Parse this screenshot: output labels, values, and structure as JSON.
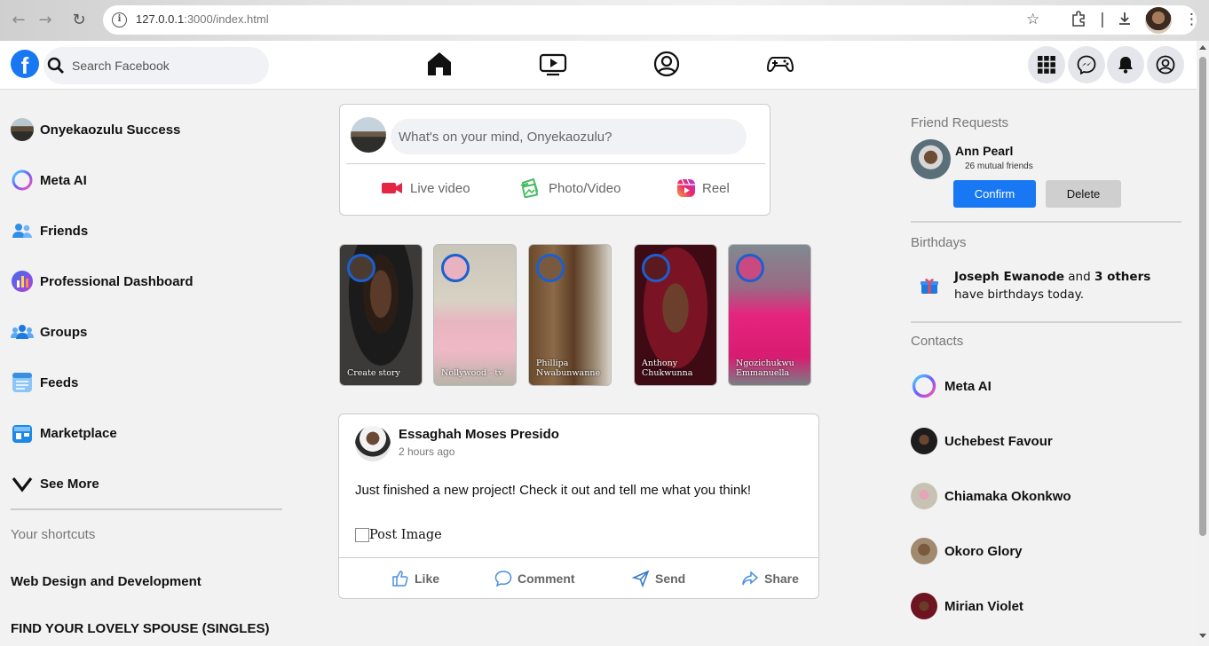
{
  "browser": {
    "url_host": "127.0.0.1",
    "url_rest": ":3000/index.html"
  },
  "header": {
    "logo_letter": "f",
    "search_placeholder": "Search Facebook"
  },
  "left_nav": {
    "items": [
      {
        "label": "Onyekaozulu Success",
        "icon": "user-avatar"
      },
      {
        "label": "Meta AI",
        "icon": "meta-ai-icon"
      },
      {
        "label": "Friends",
        "icon": "friends-icon"
      },
      {
        "label": "Professional Dashboard",
        "icon": "dashboard-icon"
      },
      {
        "label": "Groups",
        "icon": "groups-icon"
      },
      {
        "label": "Feeds",
        "icon": "feeds-icon"
      },
      {
        "label": "Marketplace",
        "icon": "marketplace-icon"
      },
      {
        "label": "See More",
        "icon": "chevron-down-icon"
      }
    ],
    "shortcuts_title": "Your shortcuts",
    "shortcuts": [
      "Web Design and Development",
      "FIND YOUR LOVELY SPOUSE (SINGLES)"
    ]
  },
  "composer": {
    "placeholder": "What's on your mind, Onyekaozulu?",
    "live_label": "Live video",
    "photo_label": "Photo/Video",
    "reel_label": "Reel"
  },
  "stories": [
    {
      "name": "Create story"
    },
    {
      "name": "Nollywood - tv"
    },
    {
      "name": "Phillipa Nwabunwanne"
    },
    {
      "name": "Anthony Chukwunna"
    },
    {
      "name": "Ngozichukwu Emmanuella"
    }
  ],
  "post": {
    "author": "Essaghah Moses Presido",
    "time": "2 hours ago",
    "text": "Just finished a new project! Check it out and tell me what you think!",
    "image_alt": "Post Image",
    "actions": {
      "like": "Like",
      "comment": "Comment",
      "send": "Send",
      "share": "Share"
    }
  },
  "right": {
    "friend_requests_title": "Friend Requests",
    "request": {
      "name": "Ann Pearl",
      "mutual": "26 mutual friends",
      "confirm": "Confirm",
      "delete": "Delete"
    },
    "birthdays_title": "Birthdays",
    "birthday": {
      "name": "Joseph Ewanode",
      "and": "and",
      "others": "3 others",
      "rest": "have birthdays today."
    },
    "contacts_title": "Contacts",
    "contacts": [
      "Meta AI",
      "Uchebest Favour",
      "Chiamaka Okonkwo",
      "Okoro Glory",
      "Mirian Violet"
    ]
  },
  "colors": {
    "brand": "#1877f2",
    "story_ring": "#1b5fd1"
  }
}
